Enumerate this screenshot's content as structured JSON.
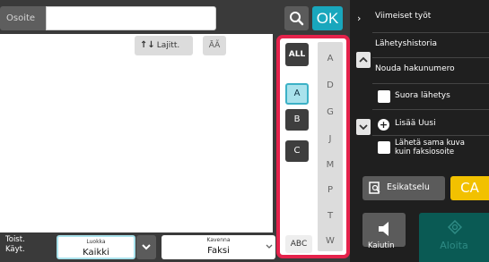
{
  "address": {
    "label": "Osoite",
    "value": ""
  },
  "header": {
    "ok_label": "OK"
  },
  "toolbar": {
    "sort_label": "Lajitt.",
    "font_toggle": "ĀÃ"
  },
  "index": {
    "all_label": "ALL",
    "letters": [
      "A",
      "D",
      "G",
      "J",
      "M",
      "P",
      "T",
      "W"
    ],
    "groups": [
      "A",
      "B",
      "C"
    ],
    "abc_label": "ABC"
  },
  "bottom": {
    "toist_line1": "Toist.",
    "toist_line2": "Käyt.",
    "category_label": "Luokka",
    "category_value": "Kaikki",
    "narrow_label": "Kavenna",
    "narrow_value": "Faksi"
  },
  "menu": {
    "items": [
      "Viimeiset työt",
      "Lähetyshistoria",
      "Nouda hakunumero",
      "Suora lähetys",
      "Lisää Uusi",
      "Lähetä sama kuva",
      "kuin faksiosoite"
    ]
  },
  "actions": {
    "preview": "Esikatselu",
    "ca": "CA",
    "speaker": "Kaiutin",
    "start": "Aloita"
  },
  "colors": {
    "accent": "#19a7bd",
    "highlight": "#e5224b",
    "ca": "#f2c100",
    "start": "#0a5a54"
  }
}
